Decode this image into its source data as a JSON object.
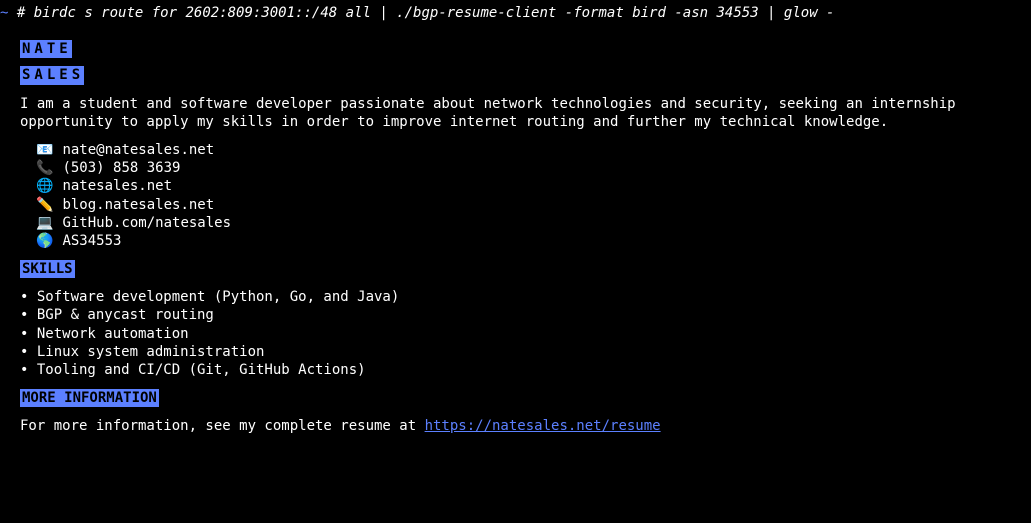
{
  "prompt": {
    "tilde": "~",
    "hash": "#",
    "command": "birdc s route for 2602:809:3001::/48 all | ./bgp-resume-client -format bird -asn 34553 | glow -"
  },
  "headers": {
    "name_first": "NATE",
    "name_last": "SALES",
    "skills": "SKILLS",
    "more": "MORE INFORMATION"
  },
  "intro": "I am a student and software developer passionate about network technologies and security, seeking an internship opportunity to apply my skills in order to improve internet routing and further my technical knowledge.",
  "contacts": [
    {
      "icon": "📧",
      "text": "nate@natesales.net"
    },
    {
      "icon": "📞",
      "text": "(503) 858 3639"
    },
    {
      "icon": "🌐",
      "text": "natesales.net"
    },
    {
      "icon": "✏️",
      "text": "blog.natesales.net"
    },
    {
      "icon": "💻",
      "text": "GitHub.com/natesales"
    },
    {
      "icon": "🌎",
      "text": "AS34553"
    }
  ],
  "skills": [
    "Software development (Python, Go, and Java)",
    "BGP & anycast routing",
    "Network automation",
    "Linux system administration",
    "Tooling and CI/CD (Git, GitHub Actions)"
  ],
  "more_info": {
    "prefix": "For more information, see my complete resume at ",
    "link": "https://natesales.net/resume"
  }
}
